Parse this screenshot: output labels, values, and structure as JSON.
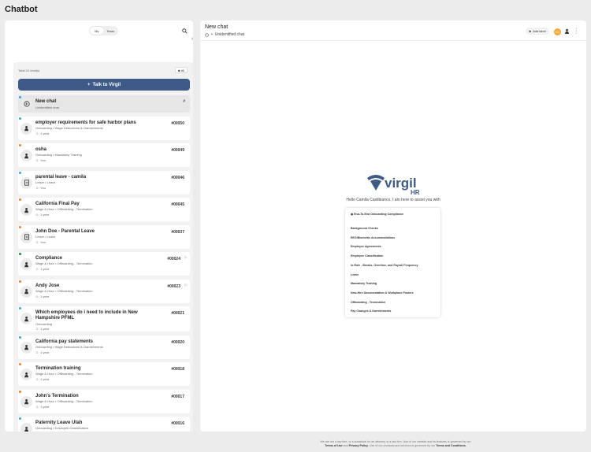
{
  "page_title": "Chatbot",
  "tabs": [
    "My",
    "Team"
  ],
  "list": {
    "total_label": "Total 24 chat(s)",
    "filter_label": "All",
    "talk_button": "Talk to Virgil",
    "items": [
      {
        "title": "New chat",
        "sub": "Unidentified chat",
        "num": "#",
        "dot": "#2aa9d8",
        "icon": "chat-circle-icon",
        "selected": true
      },
      {
        "title": "employer requirements for safe harbor plans",
        "tags": "Onboarding  •  Wage Deductions & Garnishments",
        "user": "1 year",
        "num": "#00050",
        "dot": "#2aa9d8",
        "icon": "person-icon"
      },
      {
        "title": "osha",
        "tags": "Onboarding  •  Mandatory Training",
        "user": "You",
        "num": "#00049",
        "dot": "#f07d2a",
        "icon": "person-icon"
      },
      {
        "title": "parental leave - camila",
        "tags": "Leave  •  Leave",
        "user": "You",
        "num": "#00046",
        "dot": "#2aa9d8",
        "icon": "document-icon"
      },
      {
        "title": "California Final Pay",
        "tags": "Wage & Hour  •  Offboarding - Termination",
        "user": "1 year",
        "num": "#00045",
        "dot": "#f07d2a",
        "icon": "person-icon"
      },
      {
        "title": "John Doe - Parental Leave",
        "tags": "Leave  •  Leave",
        "user": "You",
        "num": "#00037",
        "dot": "#f07d2a",
        "icon": "document-icon"
      },
      {
        "title": "Compliance",
        "tags": "Wage & Hour  •  Offboarding - Termination",
        "user": "1 year",
        "num": "#00024",
        "dot": "#1e8a3a",
        "icon": "person-icon",
        "flag": true
      },
      {
        "title": "Andy Jose",
        "tags": "Wage & Hour  •  Offboarding - Termination",
        "user": "1 year",
        "num": "#00023",
        "dot": "#f07d2a",
        "icon": "person-icon",
        "flag": true
      },
      {
        "title": "Which employees do i need to include in New Hampshire PFML",
        "tags": "Onboarding",
        "user": "1 year",
        "num": "#00021",
        "dot": "#2aa9d8",
        "icon": "person-icon"
      },
      {
        "title": "California pay statements",
        "tags": "Onboarding  •  Wage Deductions & Garnishments",
        "user": "1 year",
        "num": "#00020",
        "dot": "#2aa9d8",
        "icon": "person-icon"
      },
      {
        "title": "Termination training",
        "tags": "Wage & Hour  •  Offboarding - Termination",
        "user": "1 year",
        "num": "#00018",
        "dot": "#f07d2a",
        "icon": "person-icon"
      },
      {
        "title": "John's Termination",
        "tags": "Wage & Hour  •  Offboarding - Termination",
        "user": "1 year",
        "num": "#00017",
        "dot": "#f07d2a",
        "icon": "person-icon"
      },
      {
        "title": "Paternity Leave Utah",
        "tags": "Onboarding  •  Employee Classification",
        "user": "1 year",
        "num": "#00016",
        "dot": "#2aa9d8",
        "icon": "person-icon"
      }
    ]
  },
  "chat": {
    "title": "New chat",
    "status": "Unidentified chat",
    "add_label": "Add label",
    "avatar_initials": "CC",
    "logo_text": "virgil",
    "logo_sub": "HR",
    "greeting": "Hello Camila Castibianco, I am here to assist you with",
    "topics": [
      "End-To-End Onboarding Compliance",
      "Background Checks",
      "EEO/Biometric Accommodations",
      "Employee Agreements",
      "Employee Classification",
      "In-Role - Breaks, Overtime, and Payroll Frequency",
      "Leave",
      "Mandatory Training",
      "New-Hire Documentation & Workplace Posters",
      "Offboarding - Termination",
      "Pay Changes & Garnishments"
    ]
  },
  "disclaimer": {
    "line1": "We are not a law firm, or a substitute for an attorney or a law firm. Use of our website and its features is governed by our",
    "terms": "Terms of Use",
    "and": "and",
    "privacy": "Privacy Policy",
    "line2": ". Use of our products and services is governed by our",
    "terms2": "Terms and Conditions",
    "end": "."
  },
  "colors": {
    "accent": "#3e5b87",
    "blue_dot": "#2aa9d8",
    "orange_dot": "#f07d2a",
    "green_dot": "#1e8a3a",
    "avatar": "#f2a93b"
  }
}
